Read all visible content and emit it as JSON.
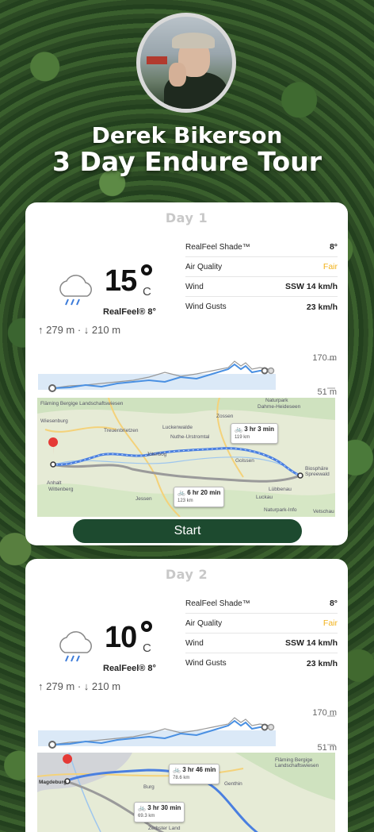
{
  "profile": {
    "name": "Derek Bikerson",
    "tour": "3 Day Endure Tour"
  },
  "days": [
    {
      "label": "Day 1",
      "temp": "15",
      "unit": "C",
      "realfeel": "RealFeel® 8°",
      "elevation": "↑ 279 m · ↓ 210 m",
      "weather_icon": "rain-cloud-icon",
      "rows": [
        {
          "label": "RealFeel Shade™",
          "value": "8°"
        },
        {
          "label": "Air Quality",
          "value": "Fair"
        },
        {
          "label": "Wind",
          "value": "SSW 14 km/h"
        },
        {
          "label": "Wind Gusts",
          "value": "23 km/h"
        }
      ],
      "profile_max": "170 m",
      "profile_min": "51 m",
      "map": {
        "main_route": {
          "time": "3 hr 3 min",
          "distance": "119 km"
        },
        "alt_route": {
          "time": "6 hr 20 min",
          "distance": "123 km"
        },
        "places": [
          "Fläming Bergige Landschaftswiesen",
          "Wiesenburg",
          "Treuenbrietzen",
          "Luckenwalde",
          "Nuthe-Urstromtal",
          "Jüterbog",
          "Golssen",
          "Biosphäre Spreewald",
          "Lübbenau",
          "Jessen",
          "Luckau",
          "Naturpark",
          "Dahme-Heideseen",
          "Zossen",
          "Wittenberg",
          "Anhalt",
          "Naturpark-Info",
          "Vetschau"
        ]
      },
      "start_label": "Start"
    },
    {
      "label": "Day 2",
      "temp": "10",
      "unit": "C",
      "realfeel": "RealFeel® 8°",
      "elevation": "↑ 279 m · ↓ 210 m",
      "weather_icon": "rain-cloud-icon",
      "rows": [
        {
          "label": "RealFeel Shade™",
          "value": "8°"
        },
        {
          "label": "Air Quality",
          "value": "Fair"
        },
        {
          "label": "Wind",
          "value": "SSW 14 km/h"
        },
        {
          "label": "Wind Gusts",
          "value": "23 km/h"
        }
      ],
      "profile_max": "170 m",
      "profile_min": "51 m",
      "map": {
        "main_route": {
          "time": "3 hr 46 min",
          "distance": "78.6 km"
        },
        "alt_route": {
          "time": "3 hr 30 min",
          "distance": "69.3 km"
        },
        "places": [
          "Magdeburg",
          "Burg",
          "Genthin",
          "Fläming Bergige Landschaftswiesen",
          "Zerbster Land"
        ]
      }
    }
  ],
  "colors": {
    "accent": "#1d4a2f",
    "fair": "#f2b21b",
    "route": "#4a7fe0"
  }
}
